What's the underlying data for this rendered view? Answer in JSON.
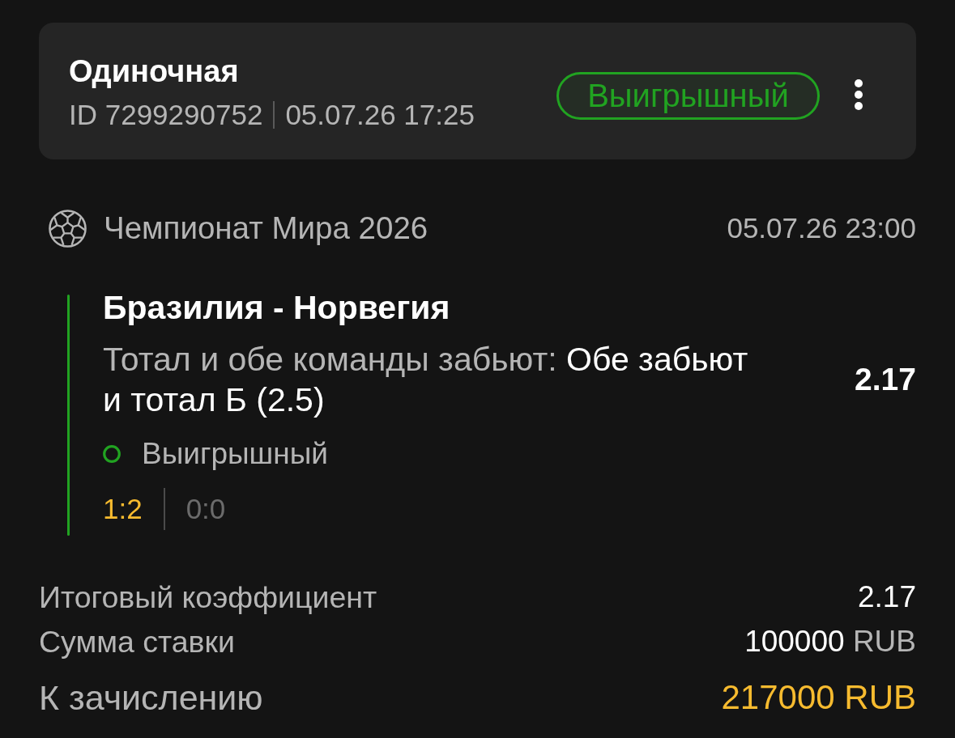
{
  "bet": {
    "type": "Одиночная",
    "id": "ID 7299290752",
    "placed": "05.07.26 17:25",
    "status": {
      "kind": "won",
      "label": "Выигрышный"
    }
  },
  "event": {
    "tournament": "Чемпионат Мира 2026",
    "start": "05.07.26 23:00",
    "match": "Бразилия - Норвегия",
    "market": "Тотал и обе команды забьют:",
    "outcome": "Обе забьют и тотал Б (2.5)",
    "odds": "2.17",
    "status": {
      "kind": "won",
      "label": "Выигрышный"
    },
    "scores": [
      {
        "text": "1:2",
        "highlighted": true
      },
      {
        "text": "0:0",
        "highlighted": false
      }
    ]
  },
  "summary": [
    {
      "kind": "regular",
      "label": "Итоговый коэффициент",
      "value": "2.17"
    },
    {
      "kind": "regular",
      "label": "Сумма ставки",
      "value": "100000",
      "currency": "RUB"
    },
    {
      "kind": "payout",
      "label": "К зачислению",
      "value": "217000",
      "currency": "RUB"
    }
  ]
}
